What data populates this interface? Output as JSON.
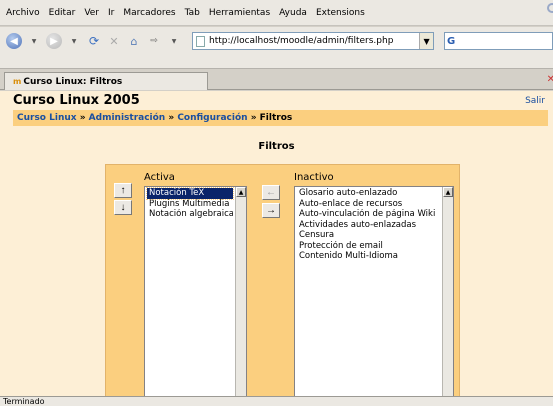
{
  "menu": [
    "Archivo",
    "Editar",
    "Ver",
    "Ir",
    "Marcadores",
    "Tab",
    "Herramientas",
    "Ayuda",
    "Extensions"
  ],
  "navbar": {
    "url": "http://localhost/moodle/admin/filters.php",
    "search_engine_letter": "G"
  },
  "tab": {
    "title": "Curso Linux: Filtros"
  },
  "page": {
    "site_title": "Curso Linux 2005",
    "logout": "Salir",
    "breadcrumb": {
      "course": "Curso Linux",
      "sep1": " » ",
      "admin": "Administración",
      "sep2": " » ",
      "config": "Configuración",
      "sep3": " » ",
      "current": "Filtros"
    },
    "heading": "Filtros",
    "active": {
      "label": "Activa",
      "items": [
        "Notación TeX",
        "Plugins Multimedia",
        "Notación algebraica"
      ],
      "selected_index": 0
    },
    "inactive": {
      "label": "Inactivo",
      "items": [
        "Glosario auto-enlazado",
        "Auto-enlace de recursos",
        "Auto-vinculación de página Wiki",
        "Actividades auto-enlazadas",
        "Censura",
        "Protección de email",
        "Contenido Multi-Idioma"
      ]
    },
    "buttons": {
      "up": "↑",
      "down": "↓",
      "left": "←",
      "right": "→"
    }
  },
  "status": "Terminado"
}
